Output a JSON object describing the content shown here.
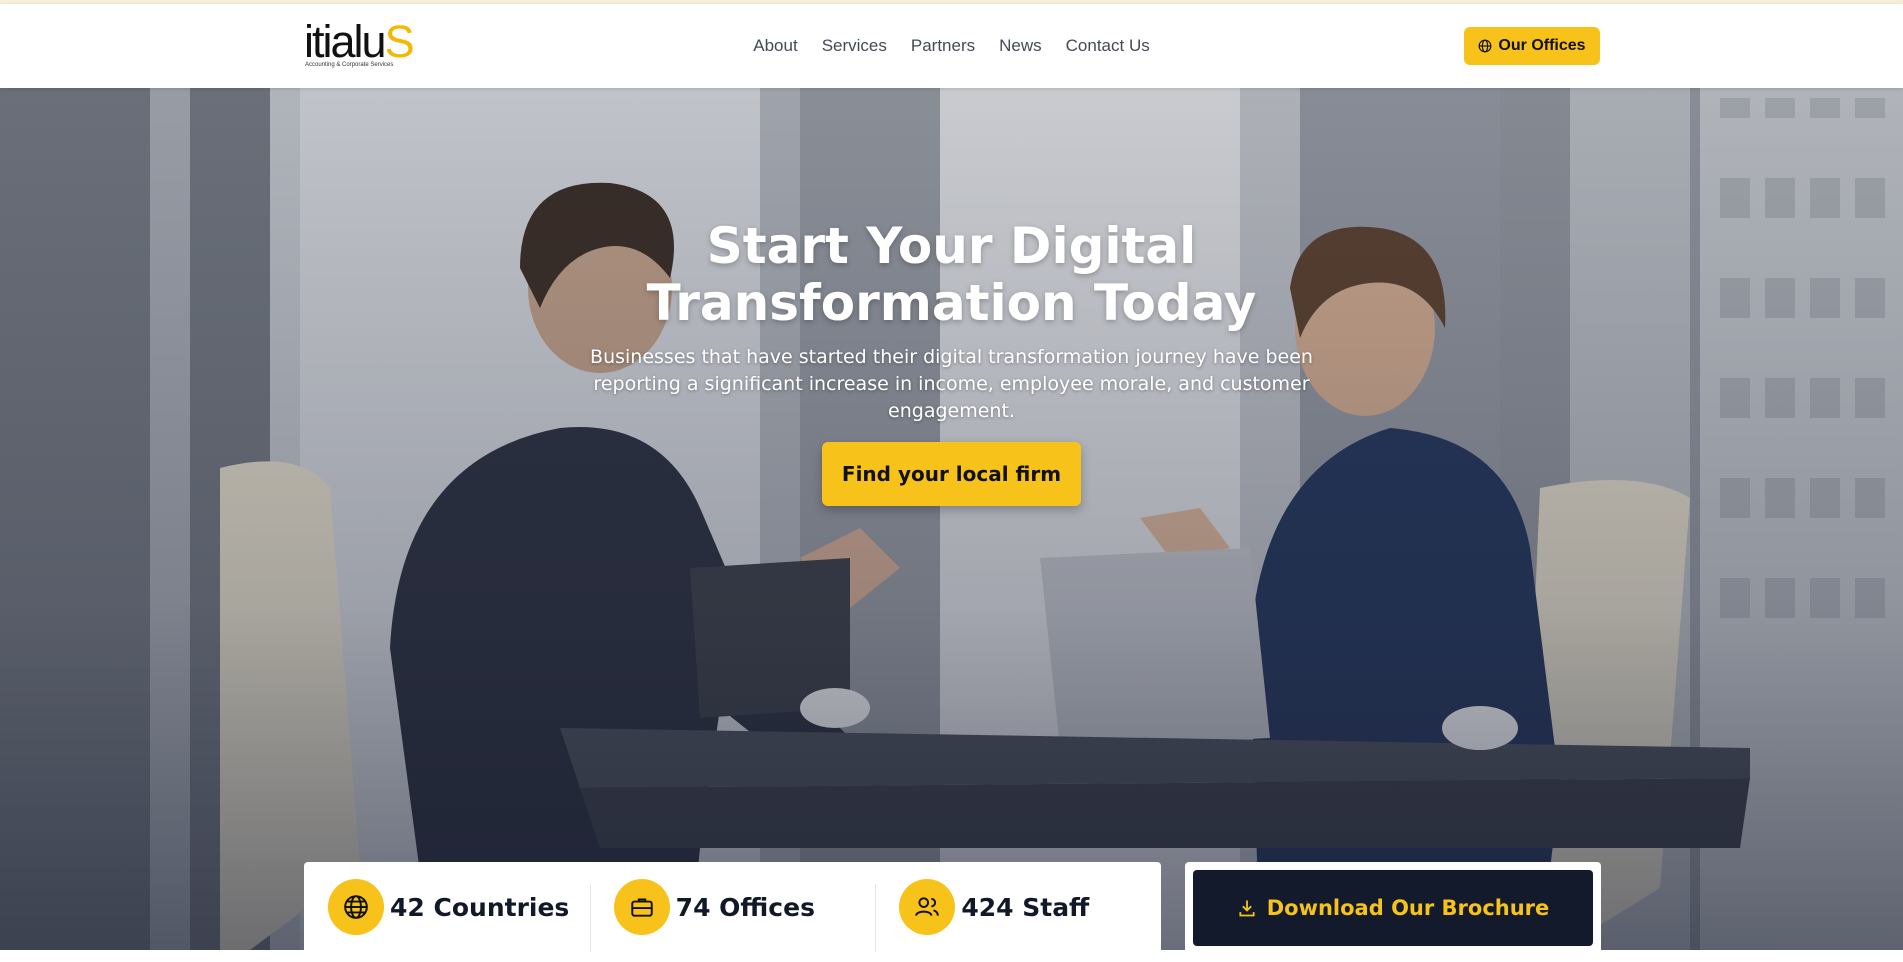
{
  "brand": {
    "logo_main": "itialu",
    "logo_accent": "S",
    "logo_tagline": "Accounting & Corporate Services",
    "accent_color": "#f7c21a",
    "dark_color": "#121a2b"
  },
  "nav": {
    "items": [
      {
        "label": "About"
      },
      {
        "label": "Services"
      },
      {
        "label": "Partners"
      },
      {
        "label": "News"
      },
      {
        "label": "Contact Us"
      }
    ],
    "cta_label": "Our Offices",
    "cta_icon": "globe-icon"
  },
  "hero": {
    "title_line1": "Start Your Digital",
    "title_line2": "Transformation Today",
    "subtitle": "Businesses that have started their digital transformation journey have been reporting a significant increase in income, employee morale, and customer engagement.",
    "button_label": "Find your local firm"
  },
  "stats": [
    {
      "icon": "globe-icon",
      "label": "42 Countries"
    },
    {
      "icon": "briefcase-icon",
      "label": "74 Offices"
    },
    {
      "icon": "users-icon",
      "label": "424 Staff"
    }
  ],
  "brochure": {
    "label": "Download Our Brochure",
    "icon": "download-icon"
  }
}
